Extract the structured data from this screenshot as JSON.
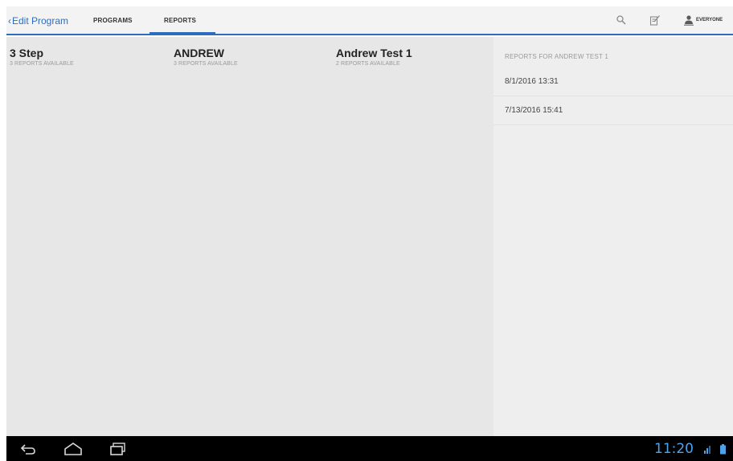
{
  "topbar": {
    "back_label": "Edit Program",
    "tabs": [
      {
        "label": "PROGRAMS",
        "selected": false
      },
      {
        "label": "REPORTS",
        "selected": true
      }
    ],
    "icons": [
      "search-icon",
      "compose-icon",
      "person-icon"
    ],
    "audience_label": "EVERYONE"
  },
  "programs": [
    {
      "name": "3 Step",
      "subtitle": "3 REPORTS AVAILABLE"
    },
    {
      "name": "ANDREW",
      "subtitle": "3 REPORTS AVAILABLE"
    },
    {
      "name": "Andrew Test 1",
      "subtitle": "2 REPORTS AVAILABLE"
    }
  ],
  "reports_panel": {
    "header": "REPORTS FOR ANDREW TEST 1",
    "reports": [
      {
        "date": "8/1/2016 13:31"
      },
      {
        "date": "7/13/2016 15:41"
      }
    ]
  },
  "system_bar": {
    "time": "11:20",
    "nav_icons": [
      "back-icon",
      "home-icon",
      "recent-apps-icon"
    ]
  },
  "colors": {
    "accent": "#2e6dbd",
    "content_bg": "#e7e7e7",
    "panel_bg": "#eeeeee",
    "clock": "#4ea3e8"
  }
}
